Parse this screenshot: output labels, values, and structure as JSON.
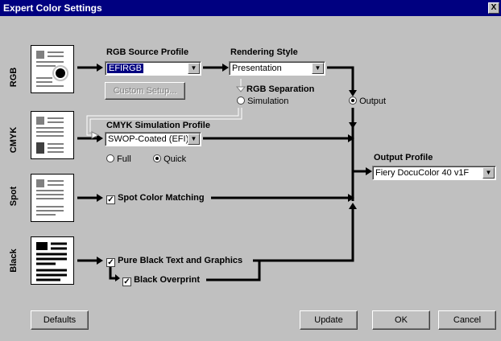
{
  "window": {
    "title": "Expert Color Settings",
    "close": "X"
  },
  "rows": {
    "rgb": "RGB",
    "cmyk": "CMYK",
    "spot": "Spot",
    "black": "Black"
  },
  "rgb_source": {
    "label": "RGB Source Profile",
    "value": "EFIRGB",
    "custom_setup": "Custom Setup..."
  },
  "rendering": {
    "label": "Rendering Style",
    "value": "Presentation"
  },
  "rgb_separation": {
    "label": "RGB Separation",
    "simulation": "Simulation",
    "output": "Output"
  },
  "cmyk_sim": {
    "label": "CMYK Simulation Profile",
    "value": "SWOP-Coated (EFI)",
    "full": "Full",
    "quick": "Quick"
  },
  "spot": {
    "label": "Spot Color Matching"
  },
  "black": {
    "pure_black": "Pure Black Text and Graphics",
    "overprint": "Black Overprint"
  },
  "output_profile": {
    "label": "Output Profile",
    "value": "Fiery DocuColor 40 v1F"
  },
  "buttons": {
    "defaults": "Defaults",
    "update": "Update",
    "ok": "OK",
    "cancel": "Cancel"
  },
  "states": {
    "simulation_selected": false,
    "output_selected": true,
    "full_selected": false,
    "quick_selected": true,
    "spot_checked": true,
    "pure_black_checked": true,
    "overprint_checked": true
  }
}
